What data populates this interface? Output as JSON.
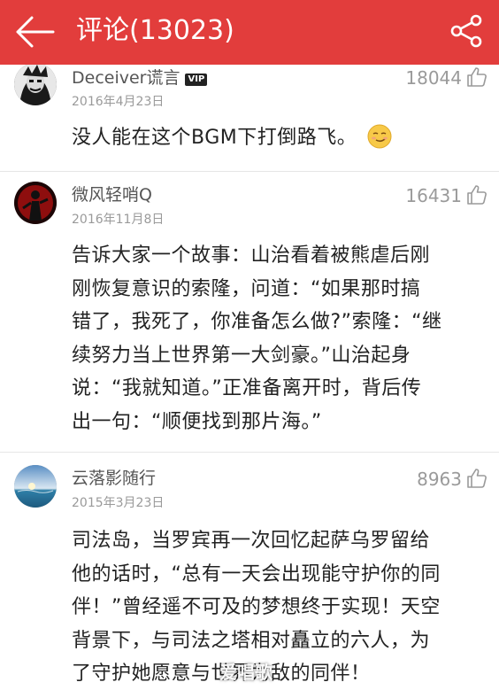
{
  "header": {
    "title": "评论(13023)",
    "bg_color": "#e23d3c",
    "back_icon": "arrow-left-icon",
    "share_icon": "share-icon"
  },
  "comments": [
    {
      "username": "Deceiver谎言",
      "badge": "VIP",
      "date": "2016年4月23日",
      "likes": "18044",
      "text": "没人能在这个BGM下打倒路飞。",
      "emoji": "smirk-face-icon"
    },
    {
      "username": "微风轻哨Q",
      "date": "2016年11月8日",
      "likes": "16431",
      "lines": [
        "告诉大家一个故事：山治看着被熊虐后刚",
        "刚恢复意识的索隆，问道：“如果那时搞",
        "错了，我死了，你准备怎么做?”索隆：“继",
        "续努力当上世界第一大剑豪。”山治起身",
        "说：“我就知道。”正准备离开时，背后传",
        "出一句：“顺便找到那片海。”"
      ]
    },
    {
      "username": "云落影随行",
      "date": "2015年3月23日",
      "likes": "8963",
      "lines": [
        "司法岛，当罗宾再一次回忆起萨乌罗留给",
        "他的话时，“总有一天会出现能守护你的同",
        "伴！”曾经遥不可及的梦想终于实现！天空",
        "背景下，与司法之塔相对矗立的六人，为",
        "了守护她愿意与世界为敌的同伴！"
      ]
    }
  ],
  "watermark": "爱唱歌"
}
